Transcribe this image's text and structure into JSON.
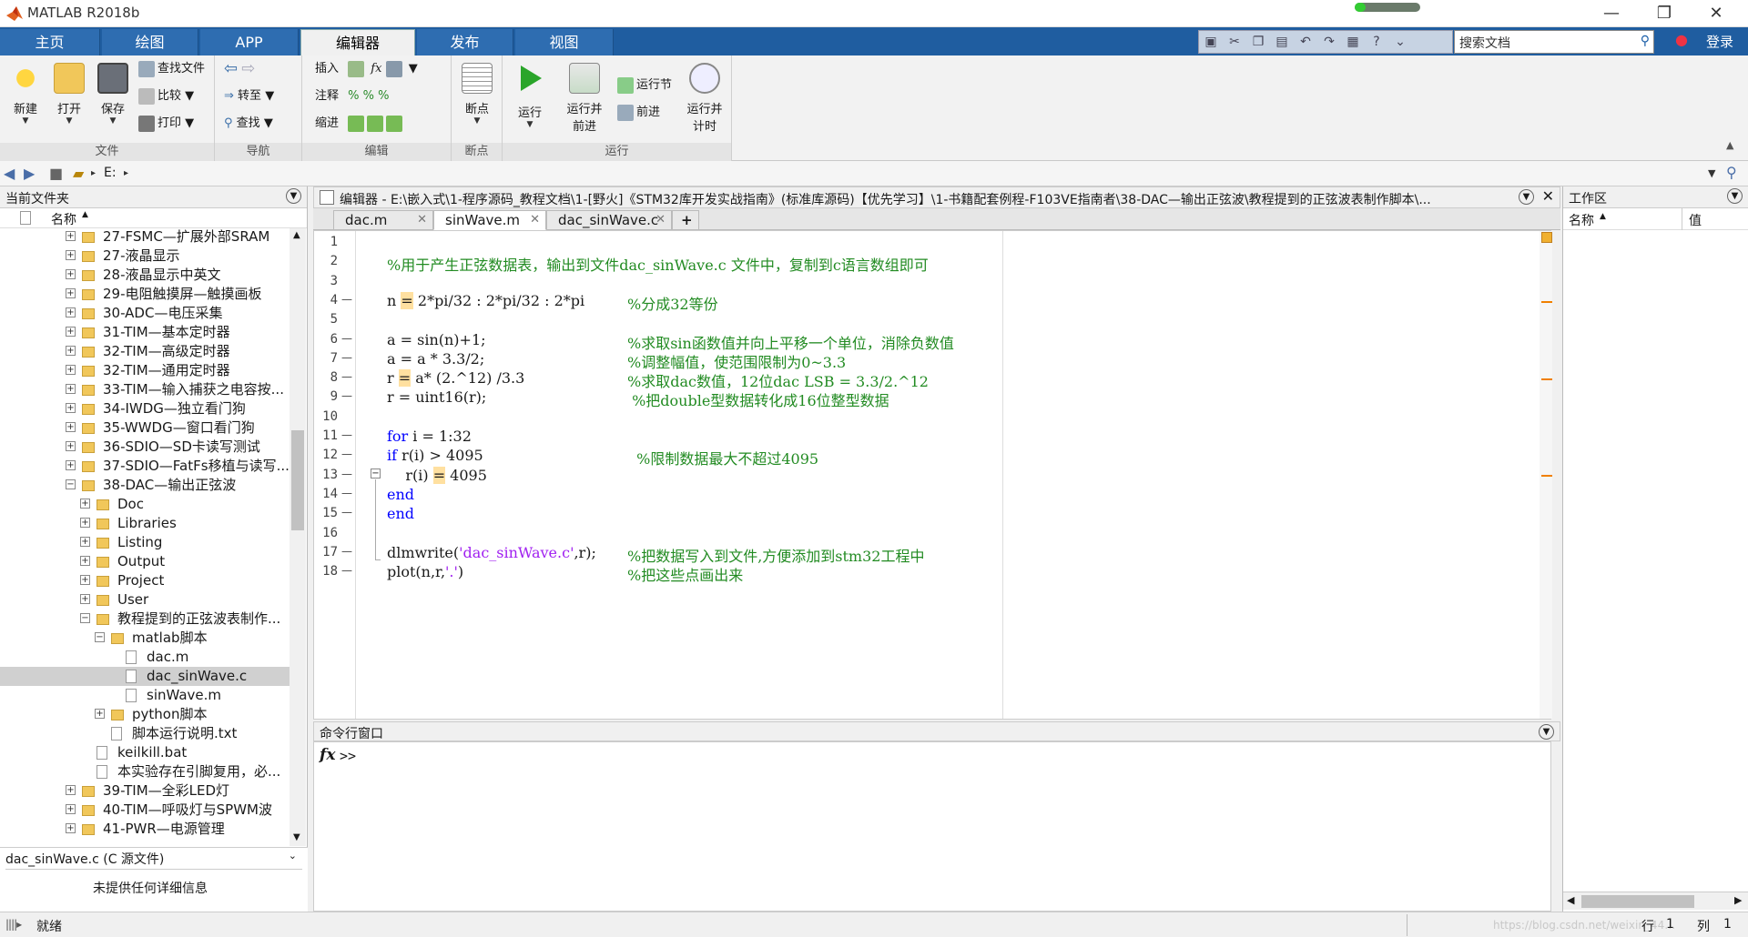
{
  "window": {
    "title": "MATLAB R2018b"
  },
  "tabs": [
    "主页",
    "绘图",
    "APP",
    "编辑器",
    "发布",
    "视图"
  ],
  "active_tab": "编辑器",
  "search": {
    "placeholder": "搜索文档"
  },
  "login": "登录",
  "ribbon": {
    "file": {
      "label": "文件",
      "new": "新建",
      "open": "打开",
      "save": "保存",
      "find_files": "查找文件",
      "compare": "比较",
      "print": "打印"
    },
    "nav": {
      "label": "导航",
      "goto": "转至",
      "find": "查找"
    },
    "edit": {
      "label": "编辑",
      "insert": "插入",
      "comment": "注释",
      "indent": "缩进"
    },
    "breakpoints": {
      "label": "断点",
      "btn": "断点"
    },
    "run": {
      "label": "运行",
      "run": "运行",
      "run_advance_1": "运行并",
      "run_advance_2": "前进",
      "run_section": "运行节",
      "advance": "前进",
      "run_time_1": "运行并",
      "run_time_2": "计时"
    }
  },
  "address": {
    "drive": "E:"
  },
  "current_folder": {
    "title": "当前文件夹",
    "col_name": "名称",
    "items": [
      {
        "label": "27-FSMC—扩展外部SRAM"
      },
      {
        "label": "27-液晶显示"
      },
      {
        "label": "28-液晶显示中英文"
      },
      {
        "label": "29-电阻触摸屏—触摸画板"
      },
      {
        "label": "30-ADC—电压采集"
      },
      {
        "label": "31-TIM—基本定时器"
      },
      {
        "label": "32-TIM—高级定时器"
      },
      {
        "label": "32-TIM—通用定时器"
      },
      {
        "label": "33-TIM—输入捕获之电容按..."
      },
      {
        "label": "34-IWDG—独立看门狗"
      },
      {
        "label": "35-WWDG—窗口看门狗"
      },
      {
        "label": "36-SDIO—SD卡读写测试"
      },
      {
        "label": "37-SDIO—FatFs移植与读写..."
      },
      {
        "label": "38-DAC—输出正弦波"
      },
      {
        "label": "Doc"
      },
      {
        "label": "Libraries"
      },
      {
        "label": "Listing"
      },
      {
        "label": "Output"
      },
      {
        "label": "Project"
      },
      {
        "label": "User"
      },
      {
        "label": "教程提到的正弦波表制作..."
      },
      {
        "label": "matlab脚本"
      },
      {
        "label": "dac.m"
      },
      {
        "label": "dac_sinWave.c"
      },
      {
        "label": "sinWave.m"
      },
      {
        "label": "python脚本"
      },
      {
        "label": "脚本运行说明.txt"
      },
      {
        "label": "keilkill.bat"
      },
      {
        "label": "本实验存在引脚复用，必..."
      },
      {
        "label": "39-TIM—全彩LED灯"
      },
      {
        "label": "40-TIM—呼吸灯与SPWM波"
      },
      {
        "label": "41-PWR—电源管理"
      }
    ],
    "details_title": "dac_sinWave.c  (C 源文件)",
    "details_body": "未提供任何详细信息"
  },
  "editor": {
    "header": "编辑器 - E:\\嵌入式\\1-程序源码_教程文档\\1-[野火]《STM32库开发实战指南》(标准库源码)【优先学习】\\1-书籍配套例程-F103VE指南者\\38-DAC—输出正弦波\\教程提到的正弦波表制作脚本\\...",
    "tabs": [
      "dac.m",
      "sinWave.m",
      "dac_sinWave.c"
    ],
    "active_tab": "sinWave.m",
    "add_tab": "+",
    "lines": [
      {
        "n": "1",
        "code": "",
        "comment": ""
      },
      {
        "n": "2",
        "code": "",
        "comment": "%用于产生正弦数据表，输出到文件dac_sinWave.c 文件中，复制到c语言数组即可"
      },
      {
        "n": "3",
        "code": "",
        "comment": ""
      },
      {
        "n": "4",
        "code": "n = 2*pi/32 : 2*pi/32 : 2*pi",
        "comment": "%分成32等份"
      },
      {
        "n": "5",
        "code": "",
        "comment": ""
      },
      {
        "n": "6",
        "code": "a = sin(n)+1;",
        "comment": "%求取sin函数值并向上平移一个单位，消除负数值"
      },
      {
        "n": "7",
        "code": "a = a * 3.3/2;",
        "comment": "%调整幅值，使范围限制为0~3.3"
      },
      {
        "n": "8",
        "code": "r = a* (2.^12) /3.3",
        "comment": "%求取dac数值，12位dac LSB = 3.3/2.^12"
      },
      {
        "n": "9",
        "code": "r = uint16(r);",
        "comment": " %把double型数据转化成16位整型数据"
      },
      {
        "n": "10",
        "code": "",
        "comment": ""
      },
      {
        "n": "11",
        "code": "for i = 1:32",
        "comment": ""
      },
      {
        "n": "12",
        "code": "if r(i) > 4095",
        "comment": "  %限制数据最大不超过4095"
      },
      {
        "n": "13",
        "code": "    r(i) = 4095",
        "comment": ""
      },
      {
        "n": "14",
        "code": "end",
        "comment": ""
      },
      {
        "n": "15",
        "code": "end",
        "comment": ""
      },
      {
        "n": "16",
        "code": "",
        "comment": ""
      },
      {
        "n": "17",
        "code": "dlmwrite('dac_sinWave.c',r);",
        "comment": "%把数据写入到文件,方便添加到stm32工程中"
      },
      {
        "n": "18",
        "code": "plot(n,r,'.')",
        "comment": "%把这些点画出来"
      }
    ]
  },
  "command_window": {
    "title": "命令行窗口",
    "prompt": ">>",
    "fx": "fx"
  },
  "workspace": {
    "title": "工作区",
    "col_name": "名称",
    "col_value": "值"
  },
  "status": {
    "text": "就绪",
    "row_label": "行",
    "row": "1",
    "col_label": "列",
    "col": "1",
    "watermark": "https://blog.csdn.net/weixin_44…"
  }
}
